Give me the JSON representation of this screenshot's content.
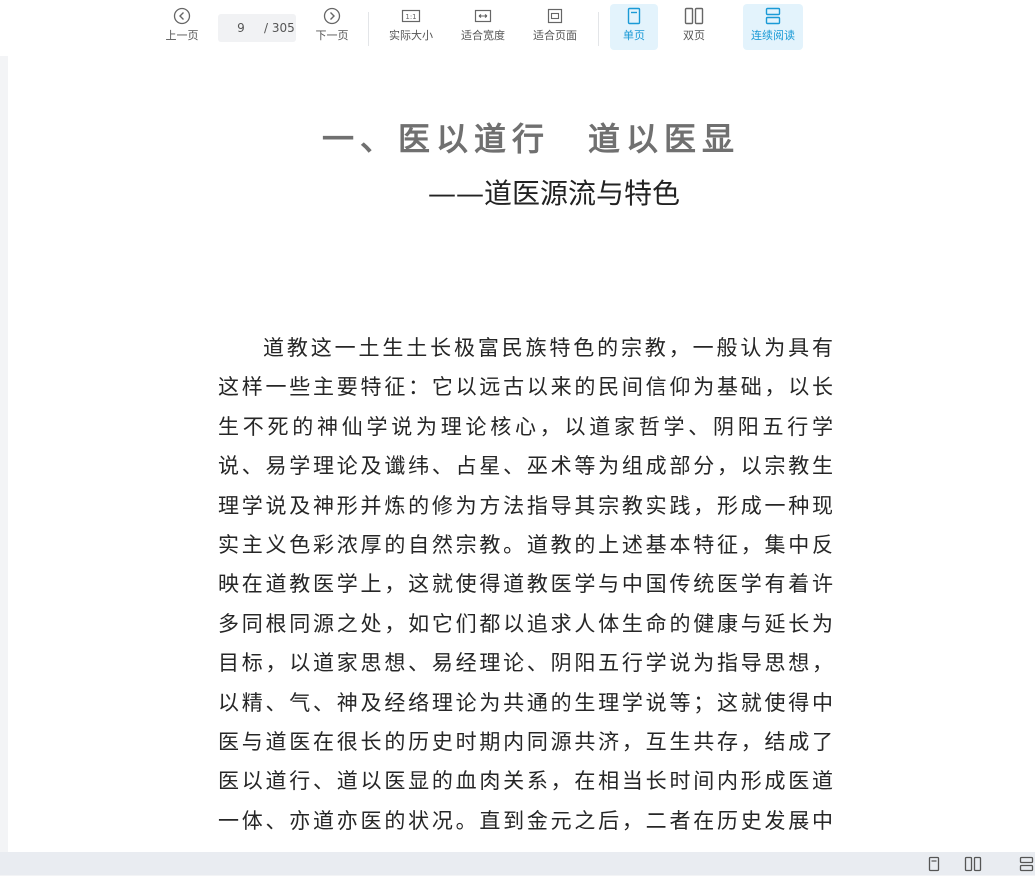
{
  "toolbar": {
    "prev_label": "上一页",
    "next_label": "下一页",
    "current_page": "9",
    "total_pages": "/ 305",
    "actual_size_label": "实际大小",
    "fit_width_label": "适合宽度",
    "fit_page_label": "适合页面",
    "single_page_label": "单页",
    "double_page_label": "双页",
    "continuous_label": "连续阅读"
  },
  "document": {
    "title": "一、医以道行　道以医显",
    "subtitle": "——道医源流与特色",
    "paragraph_lines": [
      "道教这一土生土长极富民族特色的宗教，一般认为具有",
      "这样一些主要特征：它以远古以来的民间信仰为基础，以长",
      "生不死的神仙学说为理论核心，以道家哲学、阴阳五行学",
      "说、易学理论及谶纬、占星、巫术等为组成部分，以宗教生",
      "理学说及神形并炼的修为方法指导其宗教实践，形成一种现",
      "实主义色彩浓厚的自然宗教。道教的上述基本特征，集中反",
      "映在道教医学上，这就使得道教医学与中国传统医学有着许",
      "多同根同源之处，如它们都以追求人体生命的健康与延长为",
      "目标，以道家思想、易经理论、阴阳五行学说为指导思想，",
      "以精、气、神及经络理论为共通的生理学说等；这就使得中",
      "医与道医在很长的历史时期内同源共济，互生共存，结成了",
      "医以道行、道以医显的血肉关系，在相当长时间内形成医道",
      "一体、亦道亦医的状况。直到金元之后，二者在历史发展中"
    ]
  },
  "colors": {
    "accent": "#1a9ad6",
    "active_bg": "#e3f3fc",
    "title_gray": "#707070"
  }
}
